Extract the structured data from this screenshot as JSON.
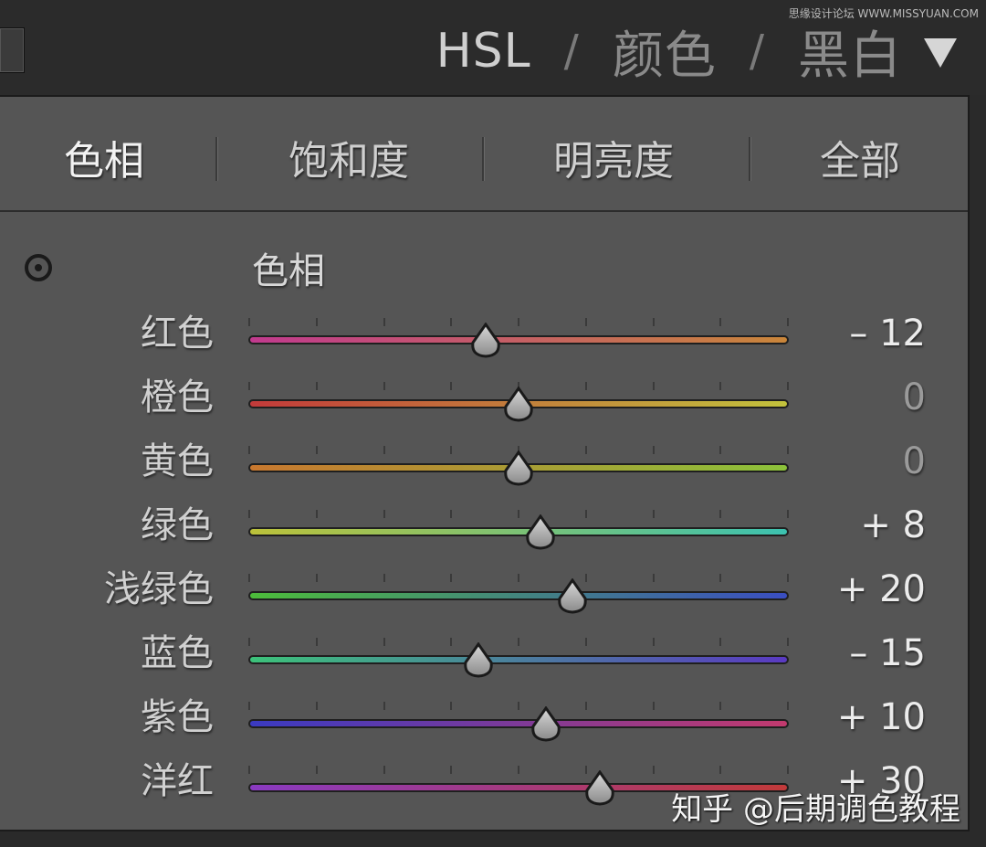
{
  "watermark_top": "思缘设计论坛 WWW.MISSYUAN.COM",
  "header": {
    "tabs": [
      "HSL",
      "颜色",
      "黑白"
    ],
    "separator": "/"
  },
  "subtabs": [
    "色相",
    "饱和度",
    "明亮度",
    "全部"
  ],
  "section_title": "色相",
  "slider_range": [
    -100,
    100
  ],
  "rows": [
    {
      "label": "红色",
      "value": "– 12",
      "num": -12,
      "from": "#c13a8e",
      "to": "#c9863a"
    },
    {
      "label": "橙色",
      "value": "0",
      "num": 0,
      "from": "#c23a3a",
      "to": "#c2c23c"
    },
    {
      "label": "黄色",
      "value": "0",
      "num": 0,
      "from": "#c8782f",
      "to": "#8cc23a"
    },
    {
      "label": "绿色",
      "value": "+ 8",
      "num": 8,
      "from": "#bcc23a",
      "to": "#3cc2b0"
    },
    {
      "label": "浅绿色",
      "value": "+ 20",
      "num": 20,
      "from": "#4cbc3a",
      "to": "#3a4ec2"
    },
    {
      "label": "蓝色",
      "value": "– 15",
      "num": -15,
      "from": "#3cc27a",
      "to": "#5a3ac2"
    },
    {
      "label": "紫色",
      "value": "+ 10",
      "num": 10,
      "from": "#3a3ac2",
      "to": "#c23a6e"
    },
    {
      "label": "洋红",
      "value": "+ 30",
      "num": 30,
      "from": "#8a3ac2",
      "to": "#c23a3a"
    }
  ],
  "footer_watermark": "知乎 @后期调色教程"
}
